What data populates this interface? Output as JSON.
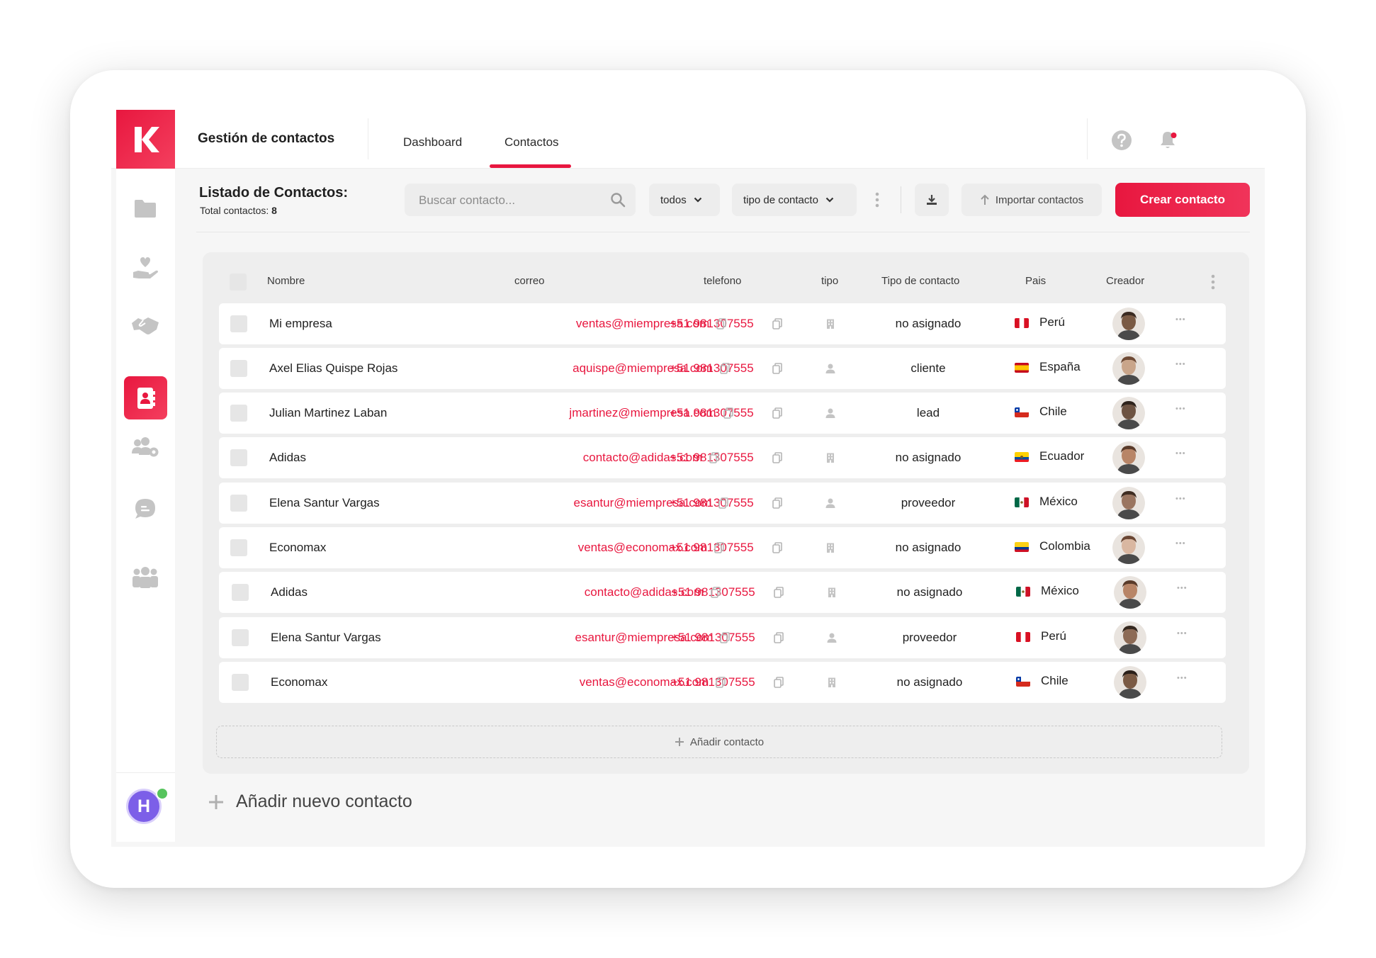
{
  "app": {
    "title": "Gestión de contactos",
    "accent": "#e8173f"
  },
  "nav": {
    "tabs": [
      {
        "label": "Dashboard",
        "active": false
      },
      {
        "label": "Contactos",
        "active": true
      }
    ]
  },
  "topbar_icons": [
    "help-icon",
    "notification-bell-icon"
  ],
  "sidebar": {
    "items": [
      "folder-icon",
      "hand-heart-icon",
      "handshake-icon",
      "contact-book-icon",
      "users-gear-icon",
      "chat-icon",
      "team-icon"
    ],
    "active_item": "contact-book-icon",
    "user_initial": "H"
  },
  "header": {
    "title": "Listado de Contactos:",
    "total_label": "Total contactos:",
    "total_count": "8",
    "search_placeholder": "Buscar contacto...",
    "filter_all": "todos",
    "filter_type": "tipo de contacto",
    "import_label": "Importar contactos",
    "create_label": "Crear contacto"
  },
  "table": {
    "columns": [
      "Nombre",
      "correo",
      "telefono",
      "tipo",
      "Tipo de contacto",
      "Pais",
      "Creador"
    ],
    "rows": [
      {
        "nombre": "Mi empresa",
        "correo": "ventas@miempresa.com",
        "telefono": "+51 981307555",
        "tipo_icon": "building-icon",
        "tipo_contacto": "no asignado",
        "pais": "Perú",
        "flag": "pe"
      },
      {
        "nombre": "Axel Elias Quispe Rojas",
        "correo": "aquispe@miempresa.com",
        "telefono": "+51 981307555",
        "tipo_icon": "person-icon",
        "tipo_contacto": "cliente",
        "pais": "España",
        "flag": "es"
      },
      {
        "nombre": "Julian Martinez Laban",
        "correo": "jmartinez@miempresa.com",
        "telefono": "+51 981307555",
        "tipo_icon": "person-icon",
        "tipo_contacto": "lead",
        "pais": "Chile",
        "flag": "cl"
      },
      {
        "nombre": "Adidas",
        "correo": "contacto@adidas.com",
        "telefono": "+51 981307555",
        "tipo_icon": "building-icon",
        "tipo_contacto": "no asignado",
        "pais": "Ecuador",
        "flag": "ec"
      },
      {
        "nombre": "Elena Santur Vargas",
        "correo": "esantur@miempresa.com",
        "telefono": "+51 981307555",
        "tipo_icon": "person-icon",
        "tipo_contacto": "proveedor",
        "pais": "México",
        "flag": "mx"
      },
      {
        "nombre": "Economax",
        "correo": "ventas@economax.com",
        "telefono": "+51 981307555",
        "tipo_icon": "building-icon",
        "tipo_contacto": "no asignado",
        "pais": "Colombia",
        "flag": "co"
      },
      {
        "nombre": "Adidas",
        "correo": "contacto@adidas.com",
        "telefono": "+51 981307555",
        "tipo_icon": "building-icon",
        "tipo_contacto": "no asignado",
        "pais": "México",
        "flag": "mx"
      },
      {
        "nombre": "Elena Santur Vargas",
        "correo": "esantur@miempresa.com",
        "telefono": "+51 981307555",
        "tipo_icon": "person-icon",
        "tipo_contacto": "proveedor",
        "pais": "Perú",
        "flag": "pe"
      },
      {
        "nombre": "Economax",
        "correo": "ventas@economax.com",
        "telefono": "+51 981307555",
        "tipo_icon": "building-icon",
        "tipo_contacto": "no asignado",
        "pais": "Chile",
        "flag": "cl"
      }
    ],
    "add_row_label": "Añadir contacto"
  },
  "footer": {
    "add_new_label": "Añadir nuevo contacto"
  }
}
